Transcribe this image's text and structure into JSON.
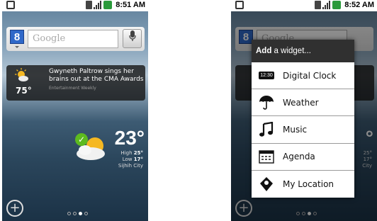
{
  "statusbar": {
    "left_time": "8:51 AM",
    "right_time": "8:52 AM"
  },
  "search": {
    "placeholder": "Google"
  },
  "news": {
    "headline": "Gwyneth Paltrow sings her brains out at the CMA Awards",
    "source": "Entertainment Weekly",
    "temp": "75°"
  },
  "weather": {
    "temp": "23°",
    "high_label": "High",
    "high": "25°",
    "low_label": "Low",
    "low": "17°",
    "city": "Sijhih City"
  },
  "widget_menu": {
    "title_bold": "Add",
    "title_rest": " a widget...",
    "items": [
      {
        "label": "Digital Clock",
        "icon": "digital-clock-icon",
        "icon_text": "12:30"
      },
      {
        "label": "Weather",
        "icon": "umbrella-icon"
      },
      {
        "label": "Music",
        "icon": "music-note-icon"
      },
      {
        "label": "Agenda",
        "icon": "calendar-icon"
      },
      {
        "label": "My Location",
        "icon": "location-pin-icon"
      }
    ]
  },
  "right_partial": {
    "degree": "°",
    "high": "25°",
    "low": "17°",
    "city_tail": "City"
  },
  "colors": {
    "statusbar_bg": "#ffffff",
    "battery": "#2a9a3a",
    "google_blue": "#2f68c9",
    "menu_title_bg": "#303030",
    "check_green": "#5dba1f"
  }
}
